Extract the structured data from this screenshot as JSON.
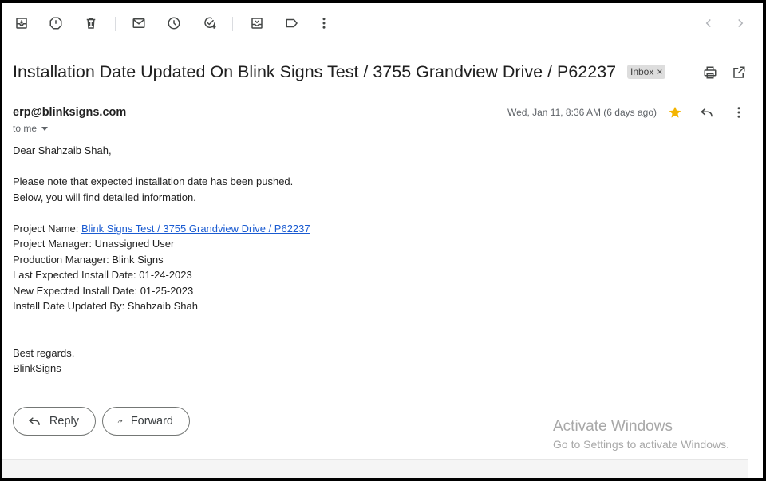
{
  "toolbar": {
    "icons": [
      "archive-icon",
      "report-spam-icon",
      "delete-icon",
      "mark-unread-icon",
      "snooze-icon",
      "add-to-tasks-icon",
      "move-to-icon",
      "label-icon",
      "more-vert-icon"
    ],
    "nav_icons": [
      "chevron-left-icon",
      "chevron-right-icon"
    ]
  },
  "email": {
    "subject": "Installation Date Updated On Blink Signs Test / 3755 Grandview Drive / P62237",
    "label": "Inbox",
    "label_remove": "×",
    "sender": "erp@blinksigns.com",
    "recipient": "to me",
    "date": "Wed, Jan 11, 8:36 AM (6 days ago)",
    "body": {
      "greeting": "Dear Shahzaib Shah,",
      "para1_line1": "Please note that expected installation date has been pushed.",
      "para1_line2": "Below, you will find detailed information.",
      "project_name_label": "Project Name: ",
      "project_name_link": "Blink Signs Test / 3755 Grandview Drive / P62237",
      "project_manager": "Project Manager: Unassigned User",
      "production_manager": "Production Manager: Blink Signs",
      "last_expected": "Last Expected Install Date: 01-24-2023",
      "new_expected": "New Expected Install Date: 01-25-2023",
      "updated_by": "Install Date Updated By: Shahzaib Shah",
      "closing": "Best regards,",
      "signature": "BlinkSigns"
    }
  },
  "actions": {
    "reply": "Reply",
    "forward": "Forward"
  },
  "watermark": {
    "title": "Activate Windows",
    "subtitle": "Go to Settings to activate Windows."
  },
  "colors": {
    "star": "#f4b400",
    "link": "#1a5bd1",
    "icon": "#444746"
  }
}
